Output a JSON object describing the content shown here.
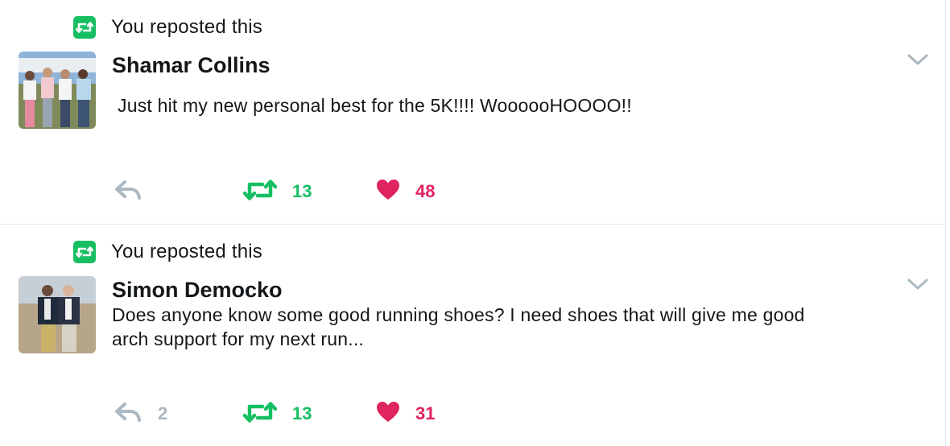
{
  "colors": {
    "retweet_green": "#17bf63",
    "like_red": "#e0245e",
    "muted_gray": "#aab8c2",
    "text": "#14171a"
  },
  "tweets": [
    {
      "repost_label": "You reposted this",
      "author": "Shamar Collins",
      "text": "Just hit my new personal best for the 5K!!!! WoooooHOOOO!!",
      "replies": "",
      "retweets": "13",
      "likes": "48",
      "icons": [
        "retweet-icon",
        "chevron-down-icon",
        "reply-icon",
        "retweet-icon",
        "heart-icon"
      ]
    },
    {
      "repost_label": "You reposted this",
      "author": "Simon Democko",
      "text": "Does anyone know some good running shoes? I need shoes that will give me good arch support for my next run...",
      "replies": "2",
      "retweets": "13",
      "likes": "31",
      "icons": [
        "retweet-icon",
        "chevron-down-icon",
        "reply-icon",
        "retweet-icon",
        "heart-icon"
      ]
    }
  ]
}
